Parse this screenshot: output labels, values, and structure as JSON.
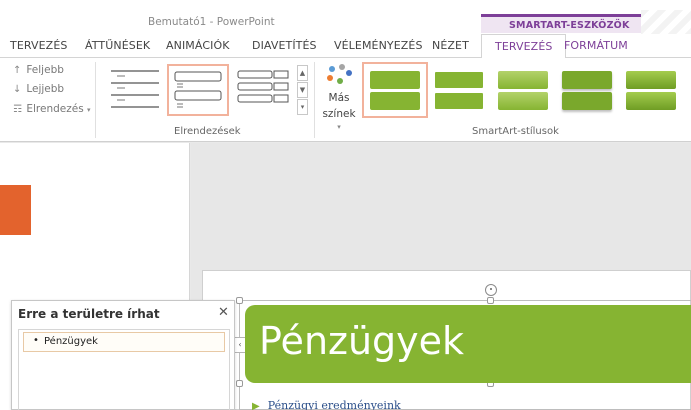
{
  "window": {
    "title": "Bemutató1 - PowerPoint",
    "context_group": "SMARTART-ESZKÖZÖK"
  },
  "tabs": [
    {
      "label": "TERVEZÉS",
      "active": false
    },
    {
      "label": "ÁTTŰNÉSEK",
      "active": false
    },
    {
      "label": "ANIMÁCIÓK",
      "active": false
    },
    {
      "label": "DIAVETÍTÉS",
      "active": false
    },
    {
      "label": "VÉLEMÉNYEZÉS",
      "active": false
    },
    {
      "label": "NÉZET",
      "active": false
    },
    {
      "label": "TERVEZÉS",
      "active": true
    },
    {
      "label": "FORMÁTUM",
      "active": false
    }
  ],
  "ribbon": {
    "create_graphic": {
      "promote": "Feljebb",
      "demote": "Lejjebb",
      "layout": "Elrendezés"
    },
    "layouts_group_label": "Elrendezések",
    "change_colors": {
      "line1": "Más",
      "line2": "színek"
    },
    "styles_group_label": "SmartArt-stílusok"
  },
  "text_pane": {
    "title": "Erre a területre írhat",
    "items": [
      "Pénzügyek"
    ]
  },
  "slide": {
    "shape_text": "Pénzügyek",
    "bullet": "Pénzügyi eredményeink"
  },
  "colors": {
    "accent": "#7d3f98",
    "smartart_green": "#86b432",
    "selection": "#f2b29c",
    "slide_marker": "#e3632d"
  }
}
